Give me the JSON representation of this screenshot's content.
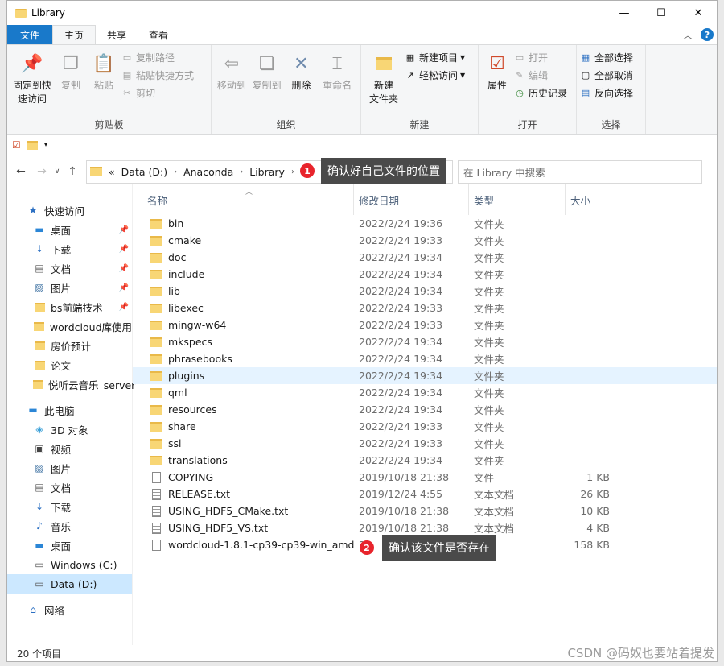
{
  "window": {
    "title": "Library",
    "minimize": "—",
    "maximize": "☐",
    "close": "✕"
  },
  "menu": {
    "tabs": [
      "文件",
      "主页",
      "共享",
      "查看"
    ],
    "help": "?"
  },
  "ribbon": {
    "clipboard": {
      "label": "剪贴板",
      "pin": "固定到快\n速访问",
      "copy": "复制",
      "paste": "粘贴",
      "copy_path": "复制路径",
      "paste_shortcut": "粘贴快捷方式",
      "cut": "剪切"
    },
    "organize": {
      "label": "组织",
      "move_to": "移动到",
      "copy_to": "复制到",
      "delete": "删除",
      "rename": "重命名"
    },
    "new": {
      "label": "新建",
      "new_folder": "新建\n文件夹",
      "new_item": "新建项目",
      "easy_access": "轻松访问"
    },
    "open": {
      "label": "打开",
      "properties": "属性",
      "open": "打开",
      "edit": "编辑",
      "history": "历史记录"
    },
    "select": {
      "label": "选择",
      "select_all": "全部选择",
      "select_none": "全部取消",
      "invert": "反向选择"
    }
  },
  "address": {
    "prefix": "«",
    "segments": [
      "Data (D:)",
      "Anaconda",
      "Library"
    ],
    "search_placeholder": "在 Library 中搜索"
  },
  "columns": {
    "name": "名称",
    "date": "修改日期",
    "type": "类型",
    "size": "大小"
  },
  "nav": {
    "quick_access": "快速访问",
    "quick_items": [
      {
        "label": "桌面",
        "icon": "desktop-icon",
        "pinned": true
      },
      {
        "label": "下载",
        "icon": "download-icon",
        "pinned": true
      },
      {
        "label": "文档",
        "icon": "document-icon",
        "pinned": true
      },
      {
        "label": "图片",
        "icon": "picture-icon",
        "pinned": true
      },
      {
        "label": "bs前端技术",
        "icon": "folder-icon",
        "pinned": true
      },
      {
        "label": "wordcloud库使用",
        "icon": "folder-icon",
        "pinned": false
      },
      {
        "label": "房价预计",
        "icon": "folder-icon",
        "pinned": false
      },
      {
        "label": "论文",
        "icon": "folder-icon",
        "pinned": false
      },
      {
        "label": "悦听云音乐_server",
        "icon": "folder-icon",
        "pinned": false
      }
    ],
    "this_pc": "此电脑",
    "pc_items": [
      {
        "label": "3D 对象",
        "icon": "3d-objects-icon"
      },
      {
        "label": "视频",
        "icon": "video-icon"
      },
      {
        "label": "图片",
        "icon": "picture-icon"
      },
      {
        "label": "文档",
        "icon": "document-icon"
      },
      {
        "label": "下载",
        "icon": "download-icon"
      },
      {
        "label": "音乐",
        "icon": "music-icon"
      },
      {
        "label": "桌面",
        "icon": "desktop-icon"
      },
      {
        "label": "Windows (C:)",
        "icon": "drive-icon"
      },
      {
        "label": "Data (D:)",
        "icon": "drive-icon"
      }
    ],
    "network": "网络"
  },
  "files": [
    {
      "name": "bin",
      "date": "2022/2/24 19:36",
      "type": "文件夹",
      "size": "",
      "kind": "folder"
    },
    {
      "name": "cmake",
      "date": "2022/2/24 19:33",
      "type": "文件夹",
      "size": "",
      "kind": "folder"
    },
    {
      "name": "doc",
      "date": "2022/2/24 19:34",
      "type": "文件夹",
      "size": "",
      "kind": "folder"
    },
    {
      "name": "include",
      "date": "2022/2/24 19:34",
      "type": "文件夹",
      "size": "",
      "kind": "folder"
    },
    {
      "name": "lib",
      "date": "2022/2/24 19:34",
      "type": "文件夹",
      "size": "",
      "kind": "folder"
    },
    {
      "name": "libexec",
      "date": "2022/2/24 19:33",
      "type": "文件夹",
      "size": "",
      "kind": "folder"
    },
    {
      "name": "mingw-w64",
      "date": "2022/2/24 19:33",
      "type": "文件夹",
      "size": "",
      "kind": "folder"
    },
    {
      "name": "mkspecs",
      "date": "2022/2/24 19:34",
      "type": "文件夹",
      "size": "",
      "kind": "folder"
    },
    {
      "name": "phrasebooks",
      "date": "2022/2/24 19:34",
      "type": "文件夹",
      "size": "",
      "kind": "folder"
    },
    {
      "name": "plugins",
      "date": "2022/2/24 19:34",
      "type": "文件夹",
      "size": "",
      "kind": "folder"
    },
    {
      "name": "qml",
      "date": "2022/2/24 19:34",
      "type": "文件夹",
      "size": "",
      "kind": "folder"
    },
    {
      "name": "resources",
      "date": "2022/2/24 19:34",
      "type": "文件夹",
      "size": "",
      "kind": "folder"
    },
    {
      "name": "share",
      "date": "2022/2/24 19:33",
      "type": "文件夹",
      "size": "",
      "kind": "folder"
    },
    {
      "name": "ssl",
      "date": "2022/2/24 19:33",
      "type": "文件夹",
      "size": "",
      "kind": "folder"
    },
    {
      "name": "translations",
      "date": "2022/2/24 19:34",
      "type": "文件夹",
      "size": "",
      "kind": "folder"
    },
    {
      "name": "COPYING",
      "date": "2019/10/18 21:38",
      "type": "文件",
      "size": "1 KB",
      "kind": "file"
    },
    {
      "name": "RELEASE.txt",
      "date": "2019/12/24 4:55",
      "type": "文本文档",
      "size": "26 KB",
      "kind": "text"
    },
    {
      "name": "USING_HDF5_CMake.txt",
      "date": "2019/10/18 21:38",
      "type": "文本文档",
      "size": "10 KB",
      "kind": "text"
    },
    {
      "name": "USING_HDF5_VS.txt",
      "date": "2019/10/18 21:38",
      "type": "文本文档",
      "size": "4 KB",
      "kind": "text"
    },
    {
      "name": "wordcloud-1.8.1-cp39-cp39-win_amd...",
      "date": "2",
      "type": "",
      "size": "158 KB",
      "kind": "file"
    }
  ],
  "status": {
    "count": "20 个项目"
  },
  "annotations": [
    {
      "badge": "1",
      "text": "确认好自己文件的位置"
    },
    {
      "badge": "2",
      "text": "确认该文件是否存在"
    }
  ],
  "watermark": "CSDN @码奴也要站着提发"
}
